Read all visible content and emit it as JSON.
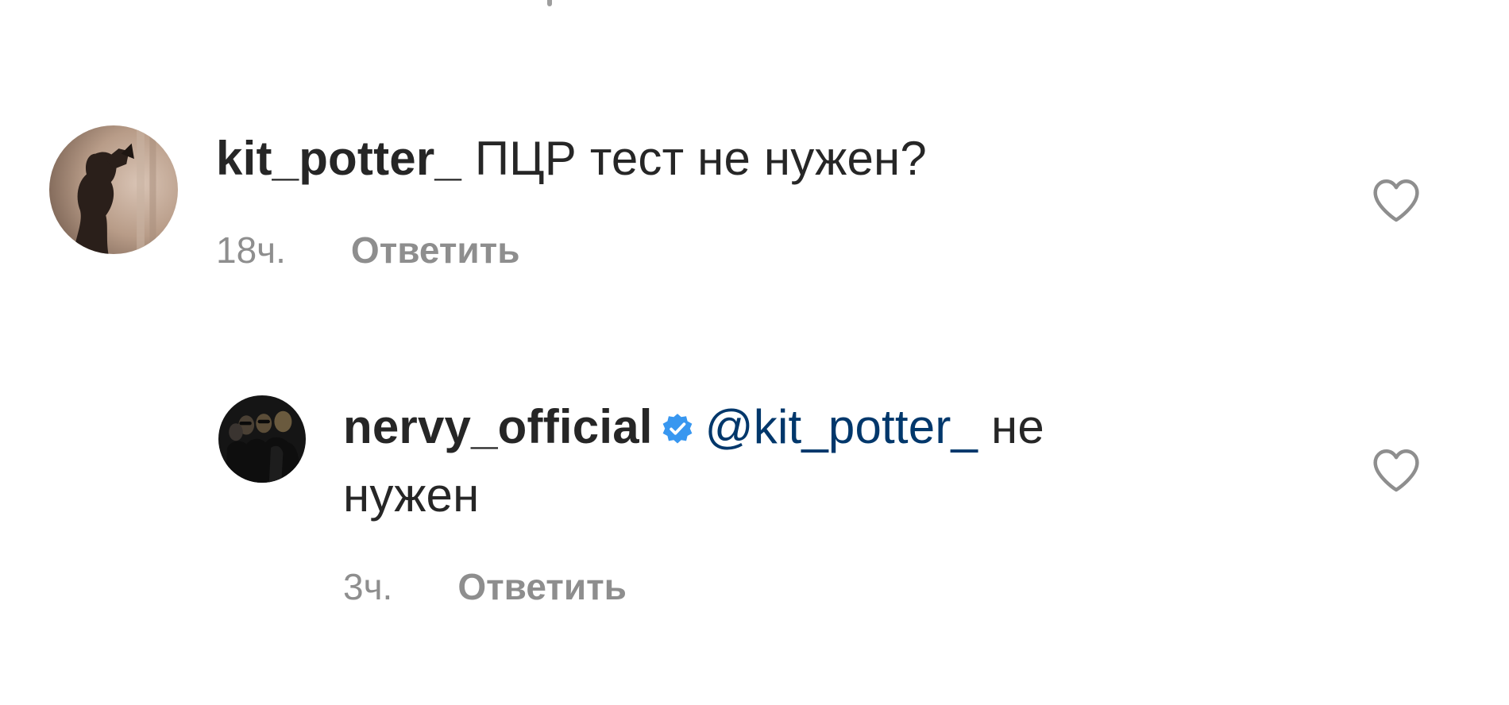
{
  "comments": [
    {
      "username": "kit_potter_",
      "text": "ПЦР тест не нужен?",
      "time": "18ч.",
      "reply_label": "Ответить",
      "avatar_icon": "profile-photo-silhouette"
    },
    {
      "username": "nervy_official",
      "verified": true,
      "mention": "@kit_potter_",
      "text_line1": " не",
      "text_line2": "нужен",
      "time": "3ч.",
      "reply_label": "Ответить",
      "avatar_icon": "profile-photo-band"
    }
  ],
  "icons": {
    "like": "heart-outline-icon",
    "verified": "verified-badge-icon"
  },
  "colors": {
    "text": "#262626",
    "secondary": "#8e8e8e",
    "mention": "#00376b",
    "verified": "#3897f0"
  }
}
